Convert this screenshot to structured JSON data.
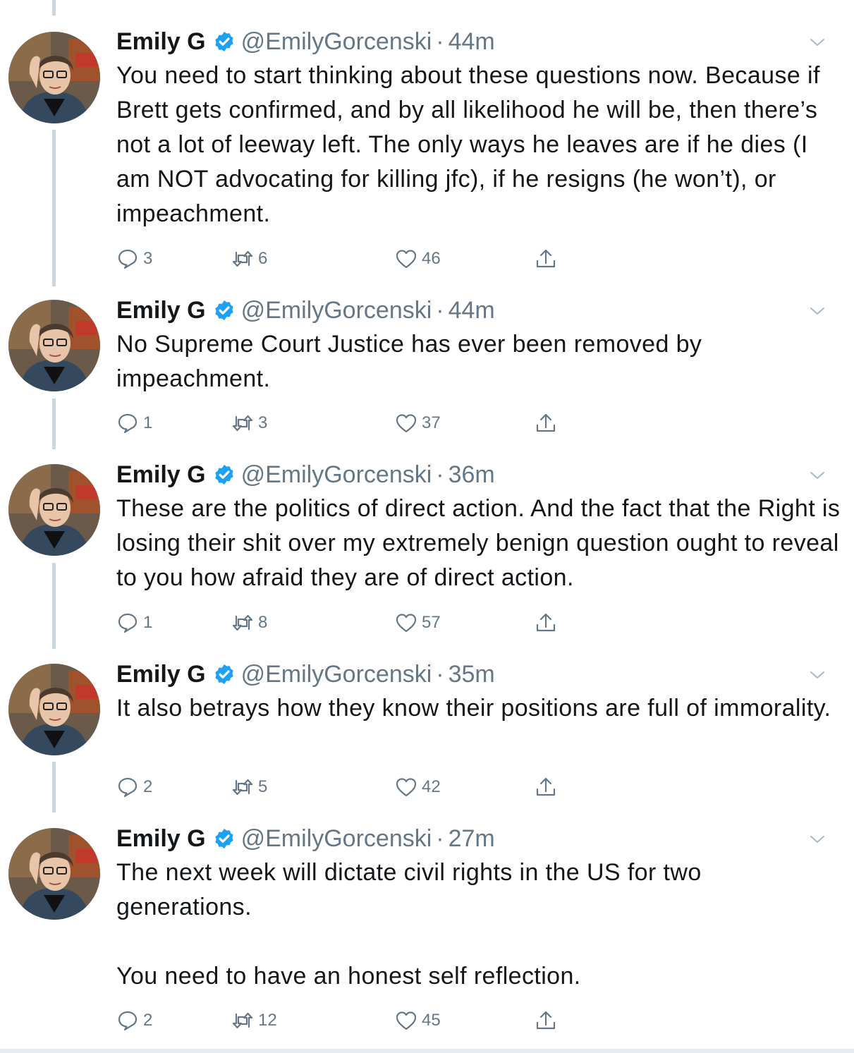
{
  "author": {
    "name": "Emily G",
    "handle": "@EmilyGorcenski",
    "verified": true,
    "verified_color": "#1da1f2"
  },
  "colors": {
    "text": "#14171a",
    "secondary": "#657786",
    "thread_line": "#ccd6dd"
  },
  "icons": {
    "reply": "reply-icon",
    "retweet": "retweet-icon",
    "like": "heart-icon",
    "share": "share-icon",
    "menu": "chevron-down-icon"
  },
  "tweets": [
    {
      "time": "44m",
      "text": "You need to start thinking about these questions now. Because if Brett gets confirmed, and by all likelihood he will be, then there’s not a lot of leeway left. The only ways he leaves are if he dies (I am NOT advocating for killing jfc), if he resigns (he won’t), or impeachment.",
      "replies": "3",
      "retweets": "6",
      "likes": "46"
    },
    {
      "time": "44m",
      "text": "No Supreme Court Justice has ever been removed by impeachment.",
      "replies": "1",
      "retweets": "3",
      "likes": "37"
    },
    {
      "time": "36m",
      "text": "These are the politics of direct action. And the fact that the Right is losing their shit over my extremely benign question ought to reveal to you how afraid they are of direct action.",
      "replies": "1",
      "retweets": "8",
      "likes": "57"
    },
    {
      "time": "35m",
      "text": "It also betrays how they know their positions are full of immorality.",
      "replies": "2",
      "retweets": "5",
      "likes": "42"
    },
    {
      "time": "27m",
      "text": "The next week will dictate civil rights in the US for two generations.\n\nYou need to have an honest self reflection.",
      "replies": "2",
      "retweets": "12",
      "likes": "45"
    }
  ]
}
